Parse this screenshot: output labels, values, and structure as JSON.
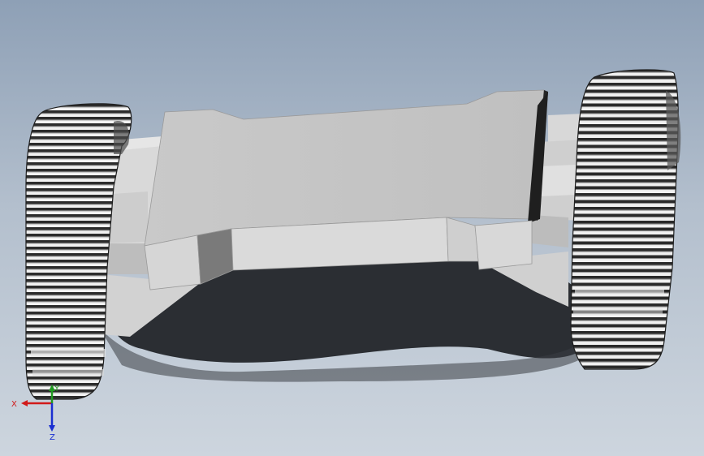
{
  "viewport": {
    "background_top": "#8ea0b6",
    "background_bottom": "#cdd5de"
  },
  "model": {
    "body_color": "#c6c6c6",
    "track_color": "#2a2a2a",
    "shadow_color": "#2b2e33"
  },
  "triad": {
    "x_label": "X",
    "y_label": "Y",
    "z_label": "Z",
    "x_color": "#d11a1a",
    "y_color": "#1f9a1f",
    "z_color": "#1a2fd1"
  }
}
